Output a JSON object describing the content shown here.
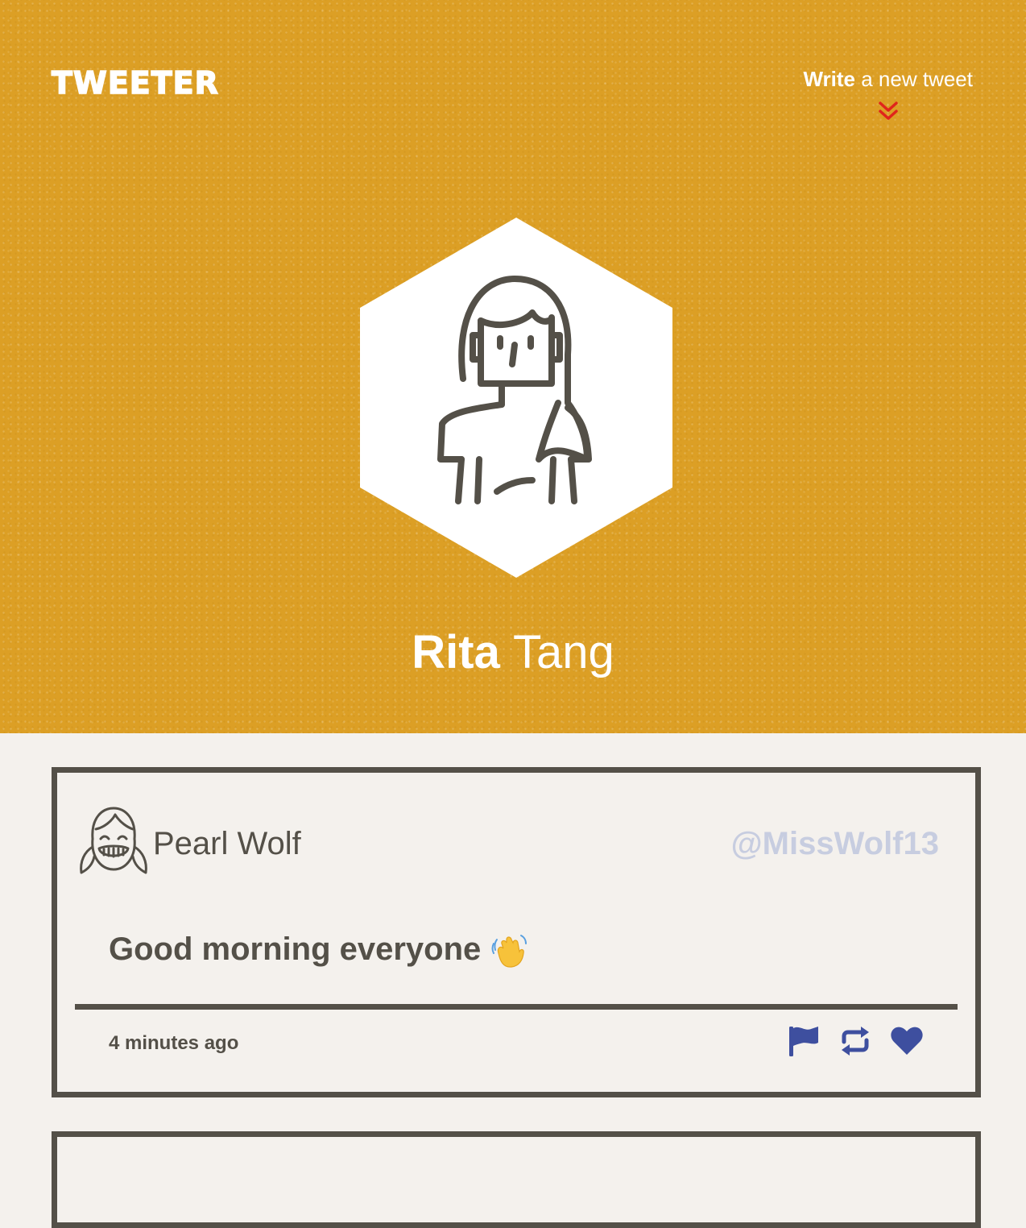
{
  "nav": {
    "brand": "TWEETER",
    "compose_strong": "Write",
    "compose_rest": " a new tweet",
    "compose_icon": "double-chevron-down-icon"
  },
  "profile": {
    "first_name": "Rita",
    "last_name": "Tang",
    "avatar_icon": "woman-avatar-icon"
  },
  "tweets": [
    {
      "name": "Pearl Wolf",
      "handle": "@MissWolf13",
      "text": "Good morning everyone",
      "emoji": "waving-hand-emoji",
      "time": "4 minutes ago",
      "avatar_icon": "girl-laughing-avatar-icon",
      "actions": [
        "flag-icon",
        "retweet-icon",
        "heart-icon"
      ]
    }
  ],
  "colors": {
    "hero_bg": "#dc9f25",
    "page_bg": "#f4f1ed",
    "border": "#545048",
    "action_blue": "#3e4f9f",
    "handle": "#c7cde0",
    "arrow_red": "#e0251b"
  }
}
